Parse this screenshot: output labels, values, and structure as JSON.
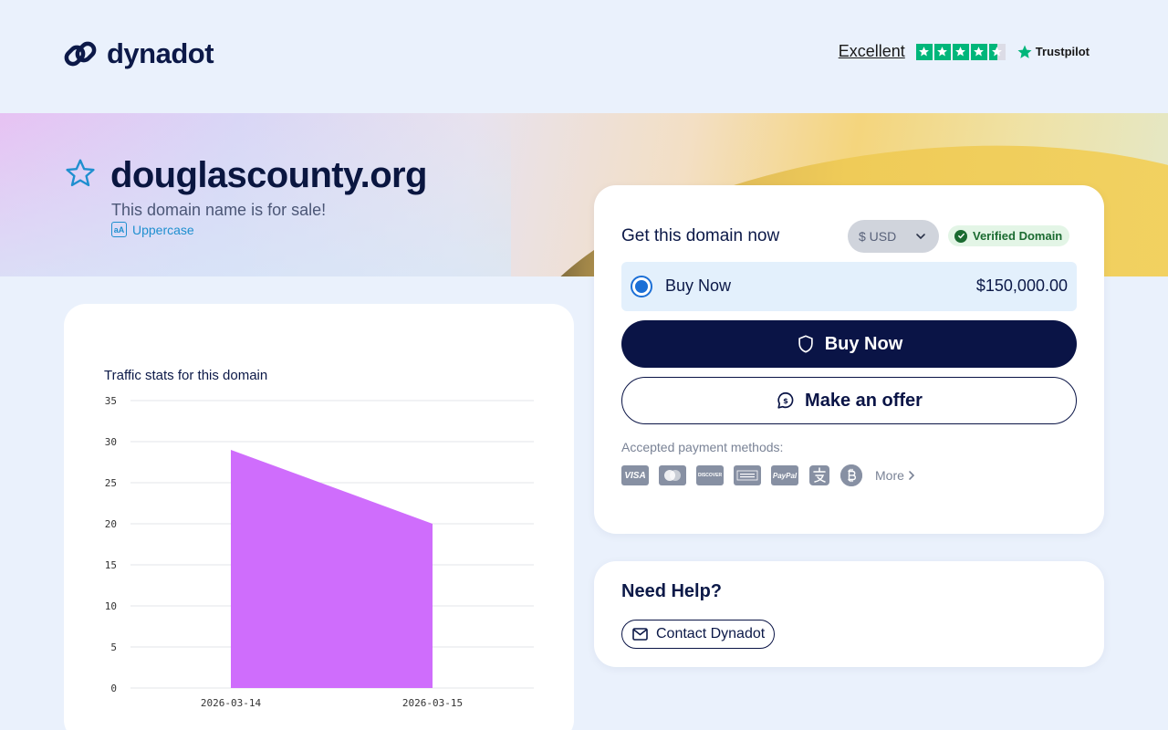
{
  "brand": {
    "name": "dynadot"
  },
  "trustpilot": {
    "rating_label": "Excellent",
    "stars": 4.5,
    "brand": "Trustpilot",
    "color": "#00b67a"
  },
  "domain": {
    "name": "douglascounty.org",
    "sale_text": "This domain name is for sale!",
    "case_toggle": "Uppercase"
  },
  "purchase": {
    "title": "Get this domain now",
    "currency": "$ USD",
    "verified": "Verified Domain",
    "option": {
      "label": "Buy Now",
      "price": "$150,000.00",
      "selected": true
    },
    "buy_button": "Buy Now",
    "offer_button": "Make an offer",
    "payment_title": "Accepted payment methods:",
    "payment_methods": [
      "visa-icon",
      "mastercard-icon",
      "discover-icon",
      "amex-icon",
      "paypal-icon",
      "alipay-icon",
      "bitcoin-icon"
    ],
    "payment_labels": {
      "visa": "VISA",
      "paypal": "PayPal",
      "discover": "DISCOVER"
    },
    "more": "More"
  },
  "help": {
    "title": "Need Help?",
    "contact": "Contact Dynadot"
  },
  "chart_data": {
    "type": "area",
    "title": "Traffic stats for this domain",
    "x": [
      "2026-03-14",
      "2026-03-15"
    ],
    "series": [
      {
        "values": [
          29,
          20
        ]
      }
    ],
    "ylim": [
      0,
      35
    ],
    "yticks": [
      0,
      5,
      10,
      15,
      20,
      25,
      30,
      35
    ],
    "grid": true,
    "color": "#cf6dfc"
  },
  "colors": {
    "navy": "#0a1446",
    "accent_blue": "#1b6fd6",
    "background": "#eaf1fc"
  }
}
